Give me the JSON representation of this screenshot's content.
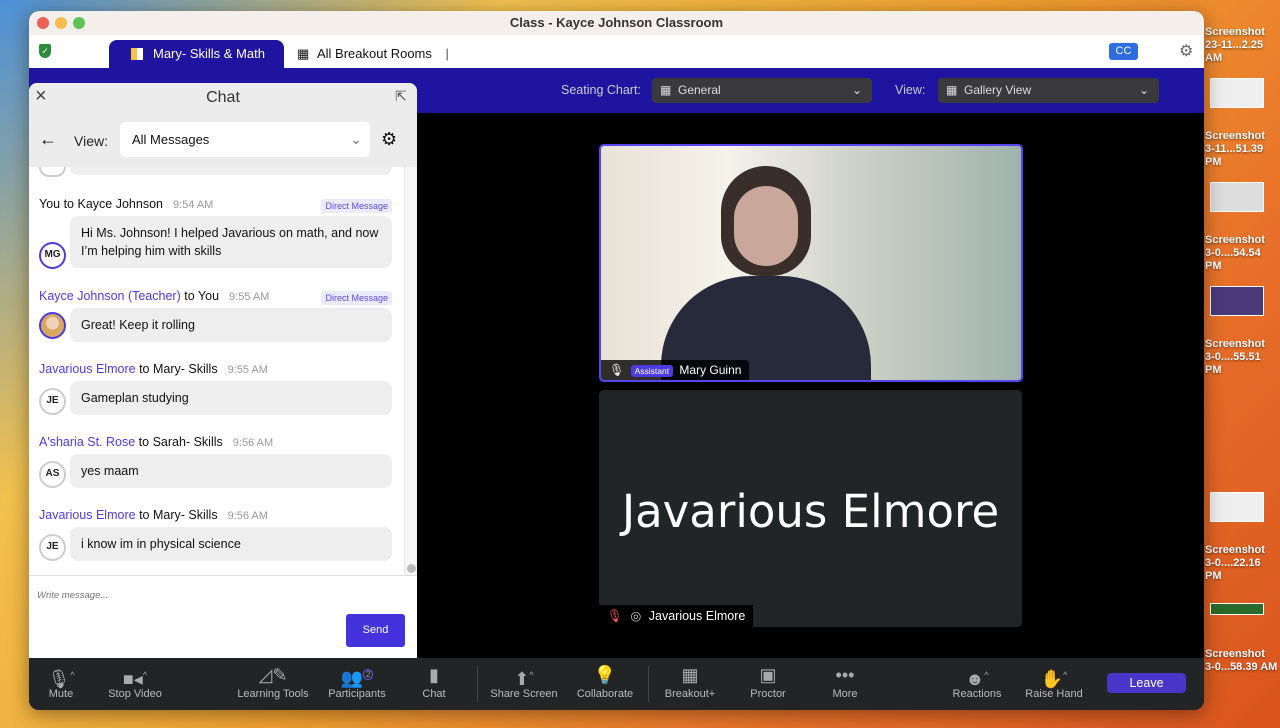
{
  "window": {
    "title": "Class - Kayce Johnson Classroom"
  },
  "tabs": [
    {
      "label": "Mary- Skills & Math",
      "active": true
    },
    {
      "label": "All Breakout Rooms"
    }
  ],
  "cc_label": "CC",
  "seating": {
    "label": "Seating Chart:",
    "value": "General"
  },
  "view": {
    "label": "View:",
    "value": "Gallery View"
  },
  "chat": {
    "title": "Chat",
    "view_label": "View:",
    "view_value": "All Messages",
    "placeholder": "Write message...",
    "send_label": "Send",
    "messages": [
      {
        "from": "You",
        "to_word": "to",
        "to": "Kayce Johnson",
        "time": "9:54 AM",
        "badge": "Direct Message",
        "text": "Hi Ms. Johnson! I helped Javarious on math, and now I’m helping him with skills",
        "initials": "MG"
      },
      {
        "from": "Kayce Johnson (Teacher)",
        "to_word": "to",
        "to": "You",
        "time": "9:55 AM",
        "badge": "Direct Message",
        "text": "Great! Keep it rolling",
        "initials": ""
      },
      {
        "from": "Javarious Elmore",
        "to_word": "to",
        "to": "Mary- Skills",
        "time": "9:55 AM",
        "text": "Gameplan studying",
        "initials": "JE"
      },
      {
        "from": "A'sharia St. Rose",
        "to_word": "to",
        "to": "Sarah- Skills",
        "time": "9:56 AM",
        "text": "yes maam",
        "initials": "AS"
      },
      {
        "from": "Javarious Elmore",
        "to_word": "to",
        "to": "Mary- Skills",
        "time": "9:56 AM",
        "text": "i know im in physical science",
        "initials": "JE"
      }
    ]
  },
  "video": {
    "tiles": [
      {
        "name": "Mary Guinn",
        "role": "Assistant"
      },
      {
        "name": "Javarious Elmore",
        "display": "Javarious Elmore"
      }
    ]
  },
  "toolbar": {
    "items": [
      {
        "label": "Mute",
        "icon": "mic-icon"
      },
      {
        "label": "Stop Video",
        "icon": "camera-icon"
      },
      {
        "label": "Learning Tools",
        "icon": "tools-icon"
      },
      {
        "label": "Participants",
        "icon": "participants-icon",
        "badge": "2"
      },
      {
        "label": "Chat",
        "icon": "chat-icon"
      },
      {
        "label": "Share Screen",
        "icon": "share-icon"
      },
      {
        "label": "Collaborate",
        "icon": "bulb-icon"
      },
      {
        "label": "Breakout+",
        "icon": "grid-icon"
      },
      {
        "label": "Proctor",
        "icon": "proctor-icon"
      },
      {
        "label": "More",
        "icon": "more-icon"
      },
      {
        "label": "Reactions",
        "icon": "smile-icon"
      },
      {
        "label": "Raise Hand",
        "icon": "hand-icon"
      }
    ],
    "leave_label": "Leave"
  },
  "desktop": [
    {
      "line1": "Screenshot",
      "line2": "23-11...2.25 AM"
    },
    {
      "line1": "Screenshot",
      "line2": "3-11...51.39 PM"
    },
    {
      "line1": "Screenshot",
      "line2": "3-0....54.54 PM"
    },
    {
      "line1": "Screenshot",
      "line2": "3-0....55.51 PM"
    },
    {
      "line1": "Screenshot",
      "line2": "3-0....22.16 PM"
    },
    {
      "line1": "Screenshot",
      "line2": "3-0...58.39 AM"
    }
  ],
  "colors": {
    "accent": "#1e14a0",
    "button": "#4433dd",
    "name": "#4b3be0"
  }
}
